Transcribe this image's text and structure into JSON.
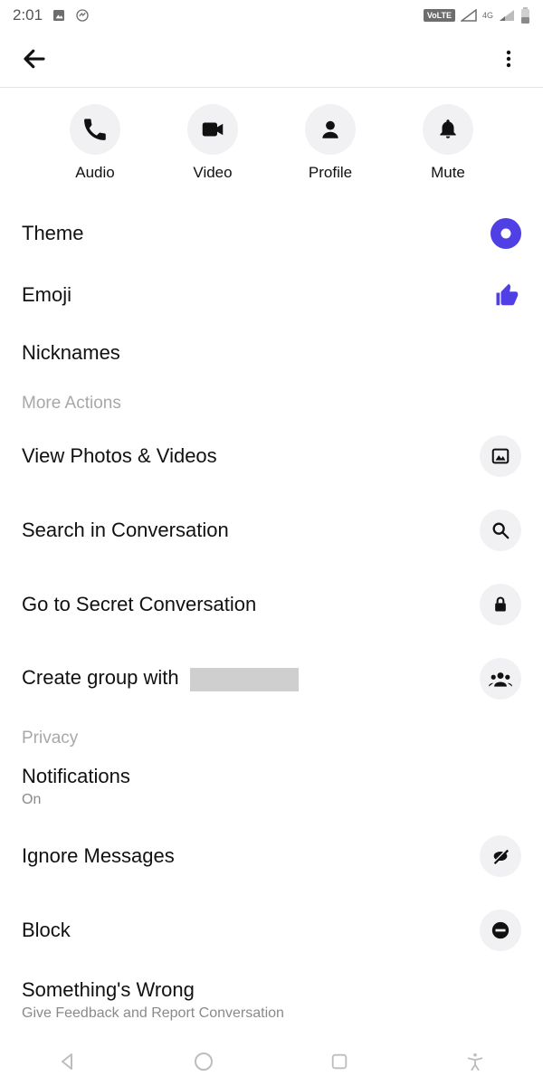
{
  "status": {
    "time": "2:01",
    "volte": "VoLTE",
    "net": "4G"
  },
  "quick": {
    "audio": "Audio",
    "video": "Video",
    "profile": "Profile",
    "mute": "Mute"
  },
  "rows": {
    "theme": "Theme",
    "emoji": "Emoji",
    "nicknames": "Nicknames"
  },
  "sections": {
    "more_actions": "More Actions",
    "privacy": "Privacy"
  },
  "more_actions": {
    "photos": "View Photos & Videos",
    "search": "Search in Conversation",
    "secret": "Go to Secret Conversation",
    "create_group_prefix": "Create group with"
  },
  "privacy": {
    "notifications": "Notifications",
    "notifications_sub": "On",
    "ignore": "Ignore Messages",
    "block": "Block",
    "wrong": "Something's Wrong",
    "wrong_sub": "Give Feedback and Report Conversation"
  }
}
